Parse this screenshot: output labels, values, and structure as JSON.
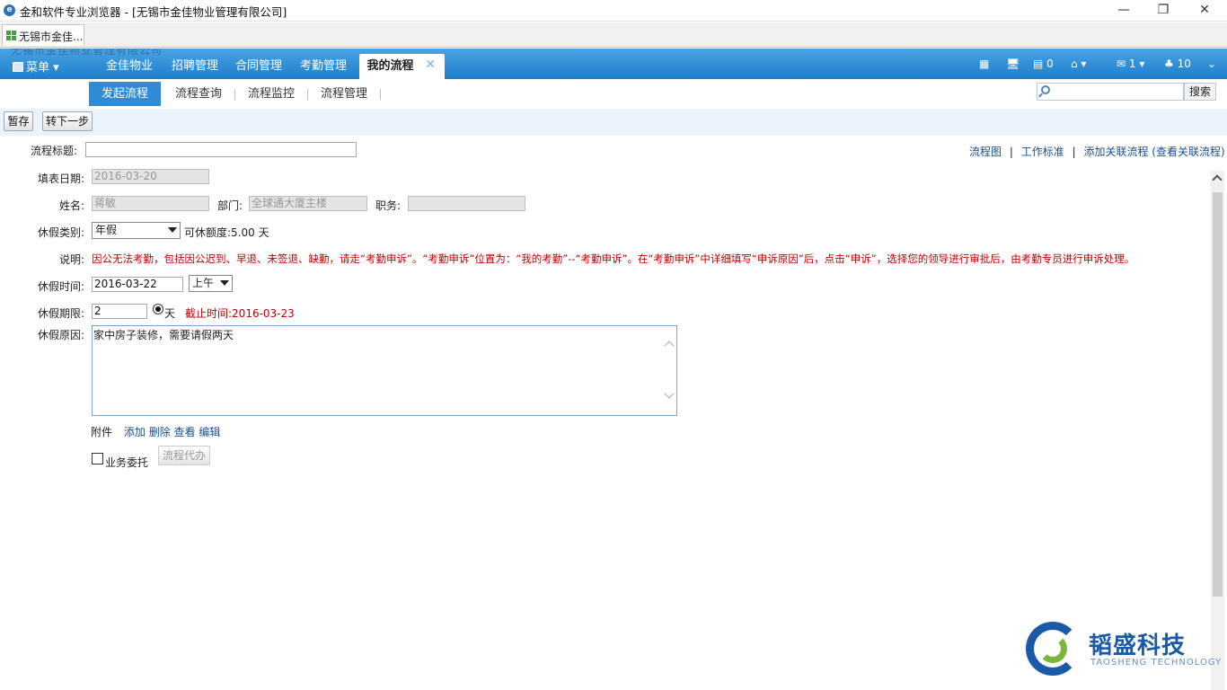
{
  "window": {
    "title": "金和软件专业浏览器 - [无锡市金佳物业管理有限公司]",
    "app_icon": "e",
    "minimize": "—",
    "restore": "❐",
    "close": "✕"
  },
  "browser_tab": {
    "label": "无锡市金佳..."
  },
  "nav": {
    "menu_label": "菜单",
    "ghost_text": "无锡市金佳物业管理有限公司",
    "tabs": [
      {
        "label": "金佳物业"
      },
      {
        "label": "招聘管理"
      },
      {
        "label": "合同管理"
      },
      {
        "label": "考勤管理"
      },
      {
        "label": "我的流程",
        "active": true
      }
    ],
    "tab_close": "✕",
    "right": {
      "doc_count": "0",
      "msg_count": "1",
      "user_count": "10"
    }
  },
  "subnav": {
    "tabs": [
      {
        "label": "发起流程",
        "active": true
      },
      {
        "label": "流程查询"
      },
      {
        "label": "流程监控"
      },
      {
        "label": "流程管理"
      }
    ],
    "search_placeholder": "",
    "search_button": "搜索"
  },
  "toolbar": {
    "save_label": "暂存",
    "next_label": "转下一步"
  },
  "form": {
    "title_label": "流程标题:",
    "title_value": "",
    "links": [
      "流程图",
      "工作标准",
      "添加关联流程",
      "(查看关联流程)"
    ],
    "link_sep": "|",
    "date_label": "填表日期:",
    "date_value": "2016-03-20",
    "name_label": "姓名:",
    "name_value": "蒋敏",
    "dept_label": "部门:",
    "dept_value": "全球通大厦主楼",
    "post_label": "职务:",
    "post_value": "",
    "leave_type_label": "休假类别:",
    "leave_type_value": "年假",
    "quota_label": "可休额度:",
    "quota_value": "5.00 天",
    "note_label": "说明:",
    "note_text": "因公无法考勤，包括因公迟到、早退、未签退、缺勤，请走“考勤申诉”。“考勤申诉”位置为：“我的考勤”--“考勤申诉”。在“考勤申诉”中详细填写“申诉原因”后，点击“申诉”，选择您的领导进行审批后，由考勤专员进行申诉处理。",
    "leave_time_label": "休假时间:",
    "leave_time_value": "2016-03-22",
    "half_day_value": "上午",
    "duration_label": "休假期限:",
    "duration_value": "2",
    "unit_label": "天",
    "deadline_label": "截止时间:",
    "deadline_value": "2016-03-23",
    "reason_label": "休假原因:",
    "reason_value": "家中房子装修，需要请假两天",
    "attach_label": "附件",
    "attach_actions": [
      "添加",
      "删除",
      "查看",
      "编辑"
    ],
    "delegate_label": "业务委托",
    "proxy_button": "流程代办"
  },
  "logo": {
    "name": "韬盛科技",
    "sub": "TAOSHENG TECHNOLOGY"
  }
}
